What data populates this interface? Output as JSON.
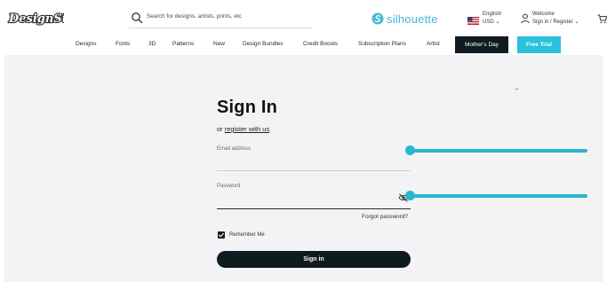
{
  "header": {
    "logo_text": "DesignStore",
    "search_placeholder": "Search for designs, artists, prints, etc",
    "silhouette_brand": "silhouette",
    "language_line1": "English/",
    "language_line2": "USD",
    "account_line1": "Welcome",
    "account_line2": "Sign in / Register"
  },
  "nav": {
    "items": [
      "Designs",
      "Fonts",
      "3D",
      "Patterns",
      "New",
      "Design Bundles",
      "Credit Boosts",
      "Subscription Plans",
      "Artist"
    ],
    "mothers_day": "Mother's Day",
    "free_trial": "Free Trial"
  },
  "signin": {
    "title": "Sign In",
    "or_text": "or",
    "register_link": "register with us",
    "email_label": "Email address",
    "email_slider_fraction": 0.0,
    "password_label": "Password",
    "password_slider_fraction": 0.0,
    "forgot_link": "Forgot password?",
    "remember_label": "Remember Me",
    "remember_checked": true,
    "submit_label": "Sign in"
  },
  "colors": {
    "accent": "#29b6cf",
    "dark_button": "#0f1b20",
    "page_bg": "#f3f3f5"
  }
}
